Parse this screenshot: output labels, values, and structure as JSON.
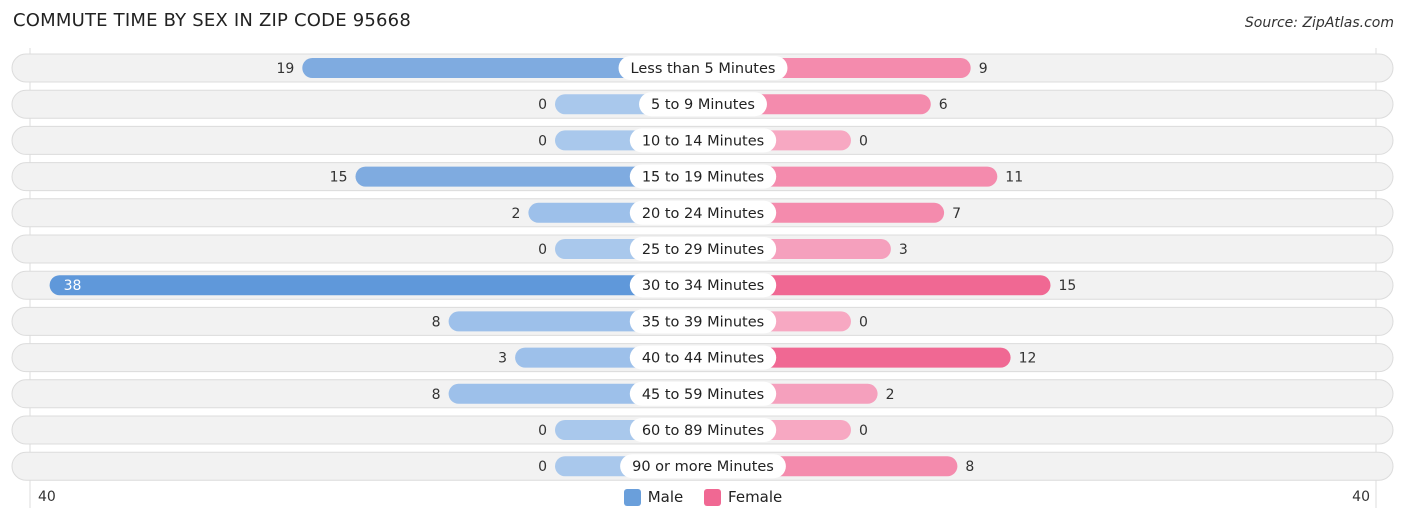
{
  "chart_data": {
    "type": "bar",
    "orientation": "horizontal-diverging",
    "title": "COMMUTE TIME BY SEX IN ZIP CODE 95668",
    "source": "Source: ZipAtlas.com",
    "categories": [
      "Less than 5 Minutes",
      "5 to 9 Minutes",
      "10 to 14 Minutes",
      "15 to 19 Minutes",
      "20 to 24 Minutes",
      "25 to 29 Minutes",
      "30 to 34 Minutes",
      "35 to 39 Minutes",
      "40 to 44 Minutes",
      "45 to 59 Minutes",
      "60 to 89 Minutes",
      "90 or more Minutes"
    ],
    "series": [
      {
        "name": "Male",
        "color": "#6a9fdb",
        "values": [
          19,
          0,
          0,
          15,
          2,
          0,
          38,
          8,
          3,
          8,
          0,
          0
        ]
      },
      {
        "name": "Female",
        "color": "#f06893",
        "values": [
          9,
          6,
          0,
          11,
          7,
          3,
          15,
          0,
          12,
          2,
          0,
          8
        ]
      }
    ],
    "axis_left_label": "40",
    "axis_right_label": "40",
    "xlim": [
      0,
      40
    ],
    "legend": [
      "Male",
      "Female"
    ],
    "legend_position": "bottom-center"
  }
}
